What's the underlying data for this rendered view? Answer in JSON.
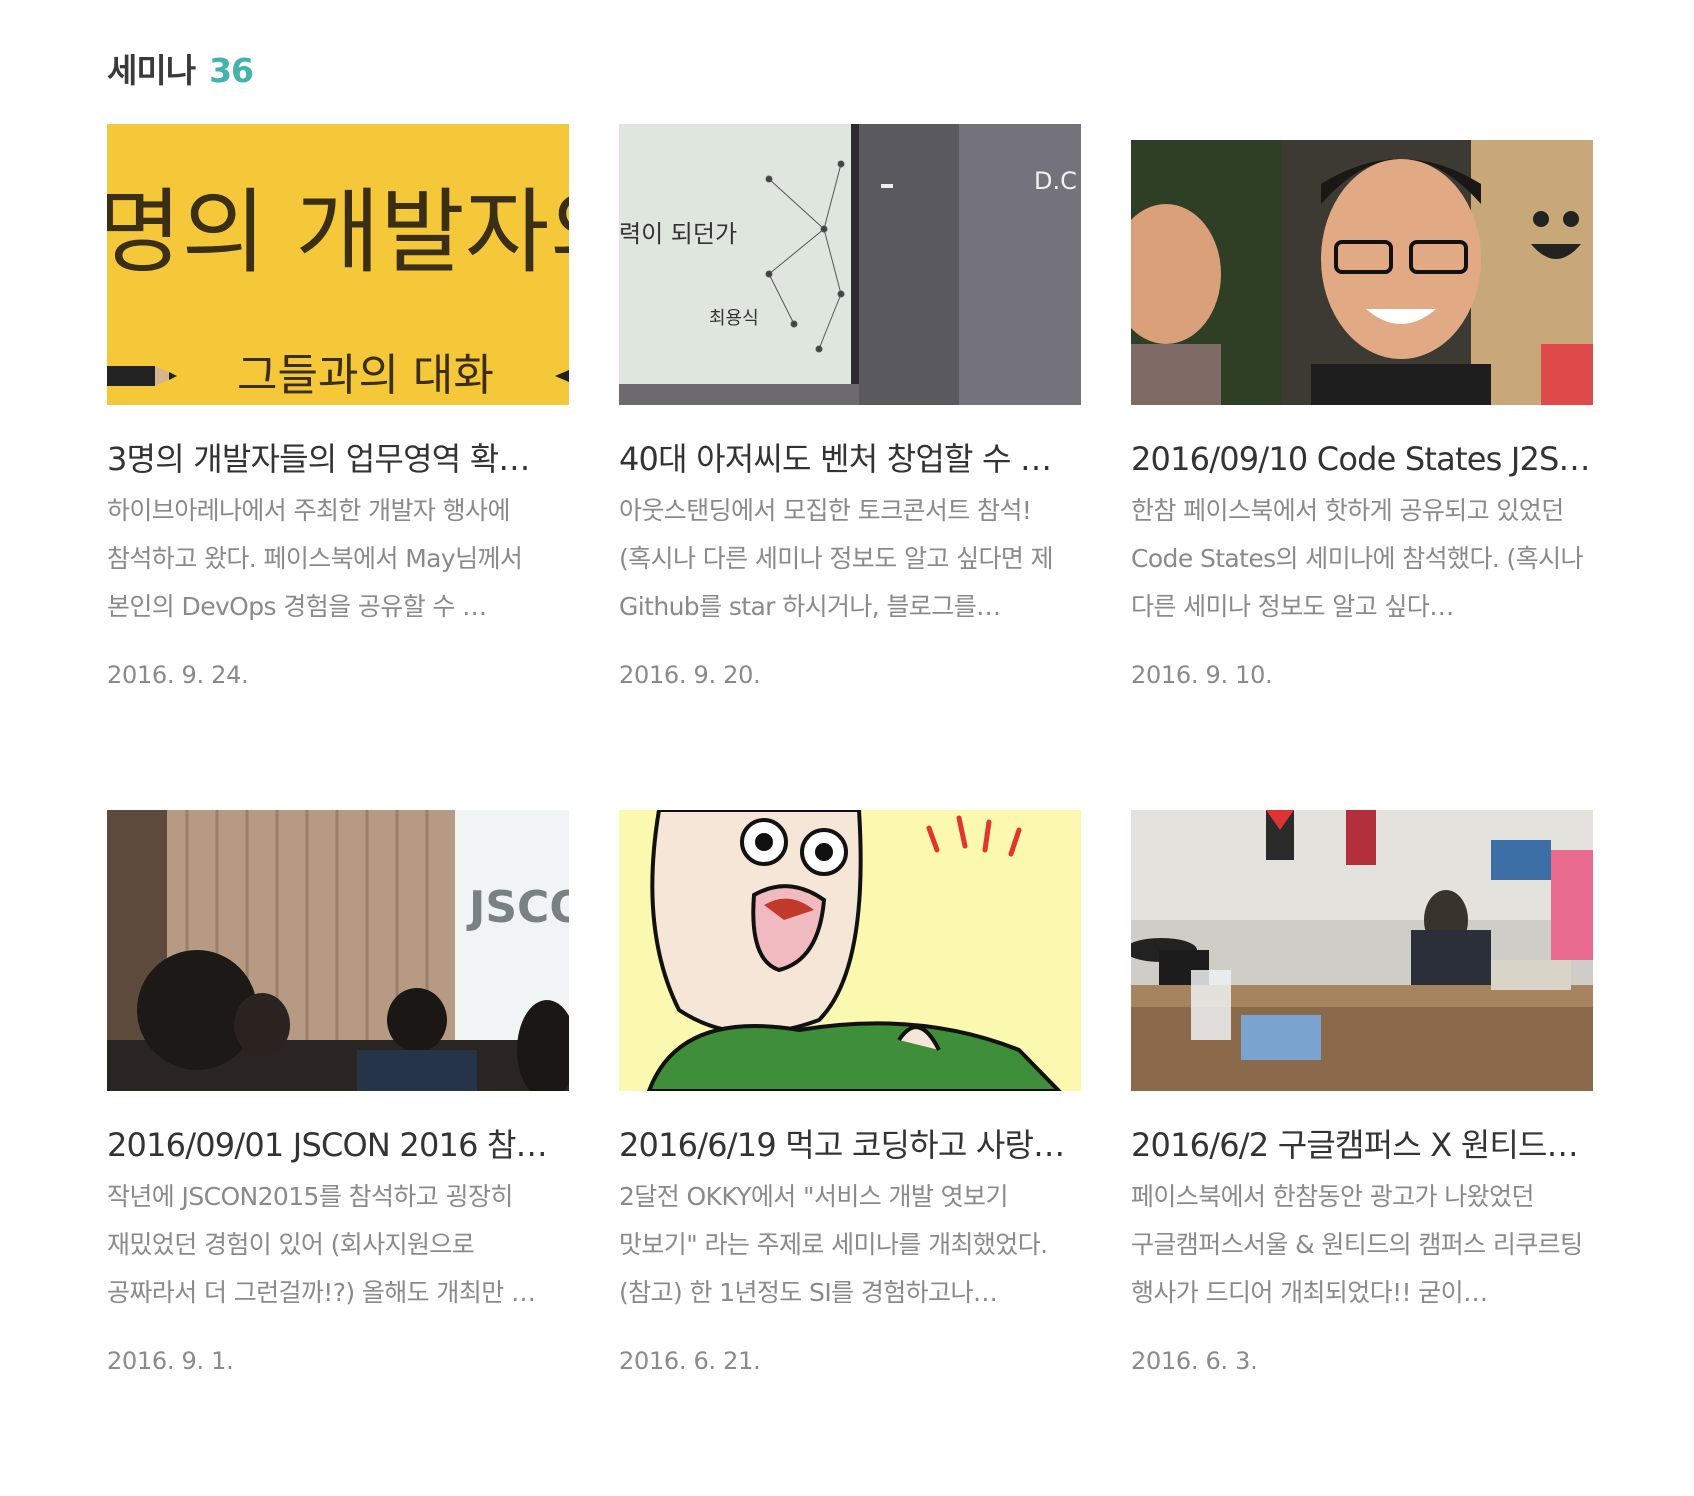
{
  "section": {
    "title": "세미나",
    "count": "36"
  },
  "cards": [
    {
      "title": "3명의 개발자들의 업무영역 확…",
      "description": "하이브아레나에서 주최한 개발자 행사에 참석하고 왔다. 페이스북에서 May님께서 본인의 DevOps 경험을 공유할 수 …",
      "date": "2016. 9. 24.",
      "thumb_text_big": "명의 개발자의",
      "thumb_text_small": "그들과의 대화",
      "thumb_icon": "yellow-banner-image"
    },
    {
      "title": "40대 아저씨도 벤처 창업할 수 …",
      "description": "아웃스탠딩에서 모집한 토크콘서트 참석! (혹시나 다른 세미나 정보도 알고 싶다면 제 Github를 star 하시거나, 블로그를…",
      "date": "2016. 9. 20.",
      "thumb_text_big": "력이 되던가",
      "thumb_text_small": "최용식",
      "thumb_text_sign": "D.C",
      "thumb_icon": "presentation-screen-image"
    },
    {
      "title": "2016/09/10 Code States J2S…",
      "description": "한참 페이스북에서 핫하게 공유되고 있었던 Code States의 세미나에 참석했다. (혹시나 다른 세미나 정보도 알고 싶다…",
      "date": "2016. 9. 10.",
      "thumb_icon": "selfie-photo-image"
    },
    {
      "title": "2016/09/01 JSCON 2016 참…",
      "description": "작년에 JSCON2015를 참석하고 굉장히 재밌었던 경험이 있어 (회사지원으로 공짜라서 더 그런걸까!?) 올해도 개최만 …",
      "date": "2016. 9. 1.",
      "thumb_text_big": "JSCO",
      "thumb_icon": "conference-hall-image"
    },
    {
      "title": "2016/6/19 먹고 코딩하고 사랑…",
      "description": "2달전 OKKY에서 \"서비스 개발 엿보기 맛보기\" 라는 주제로 세미나를 개최했었다. (참고) 한 1년정도 SI를 경험하고나…",
      "date": "2016. 6. 21.",
      "thumb_icon": "cartoon-face-image"
    },
    {
      "title": "2016/6/2 구글캠퍼스 X 원티드…",
      "description": "페이스북에서 한참동안 광고가 나왔었던 구글캠퍼스서울 & 원티드의 캠퍼스 리쿠르팅 행사가 드디어 개최되었다!! 굳이…",
      "date": "2016. 6. 3.",
      "thumb_icon": "office-lounge-image"
    }
  ]
}
